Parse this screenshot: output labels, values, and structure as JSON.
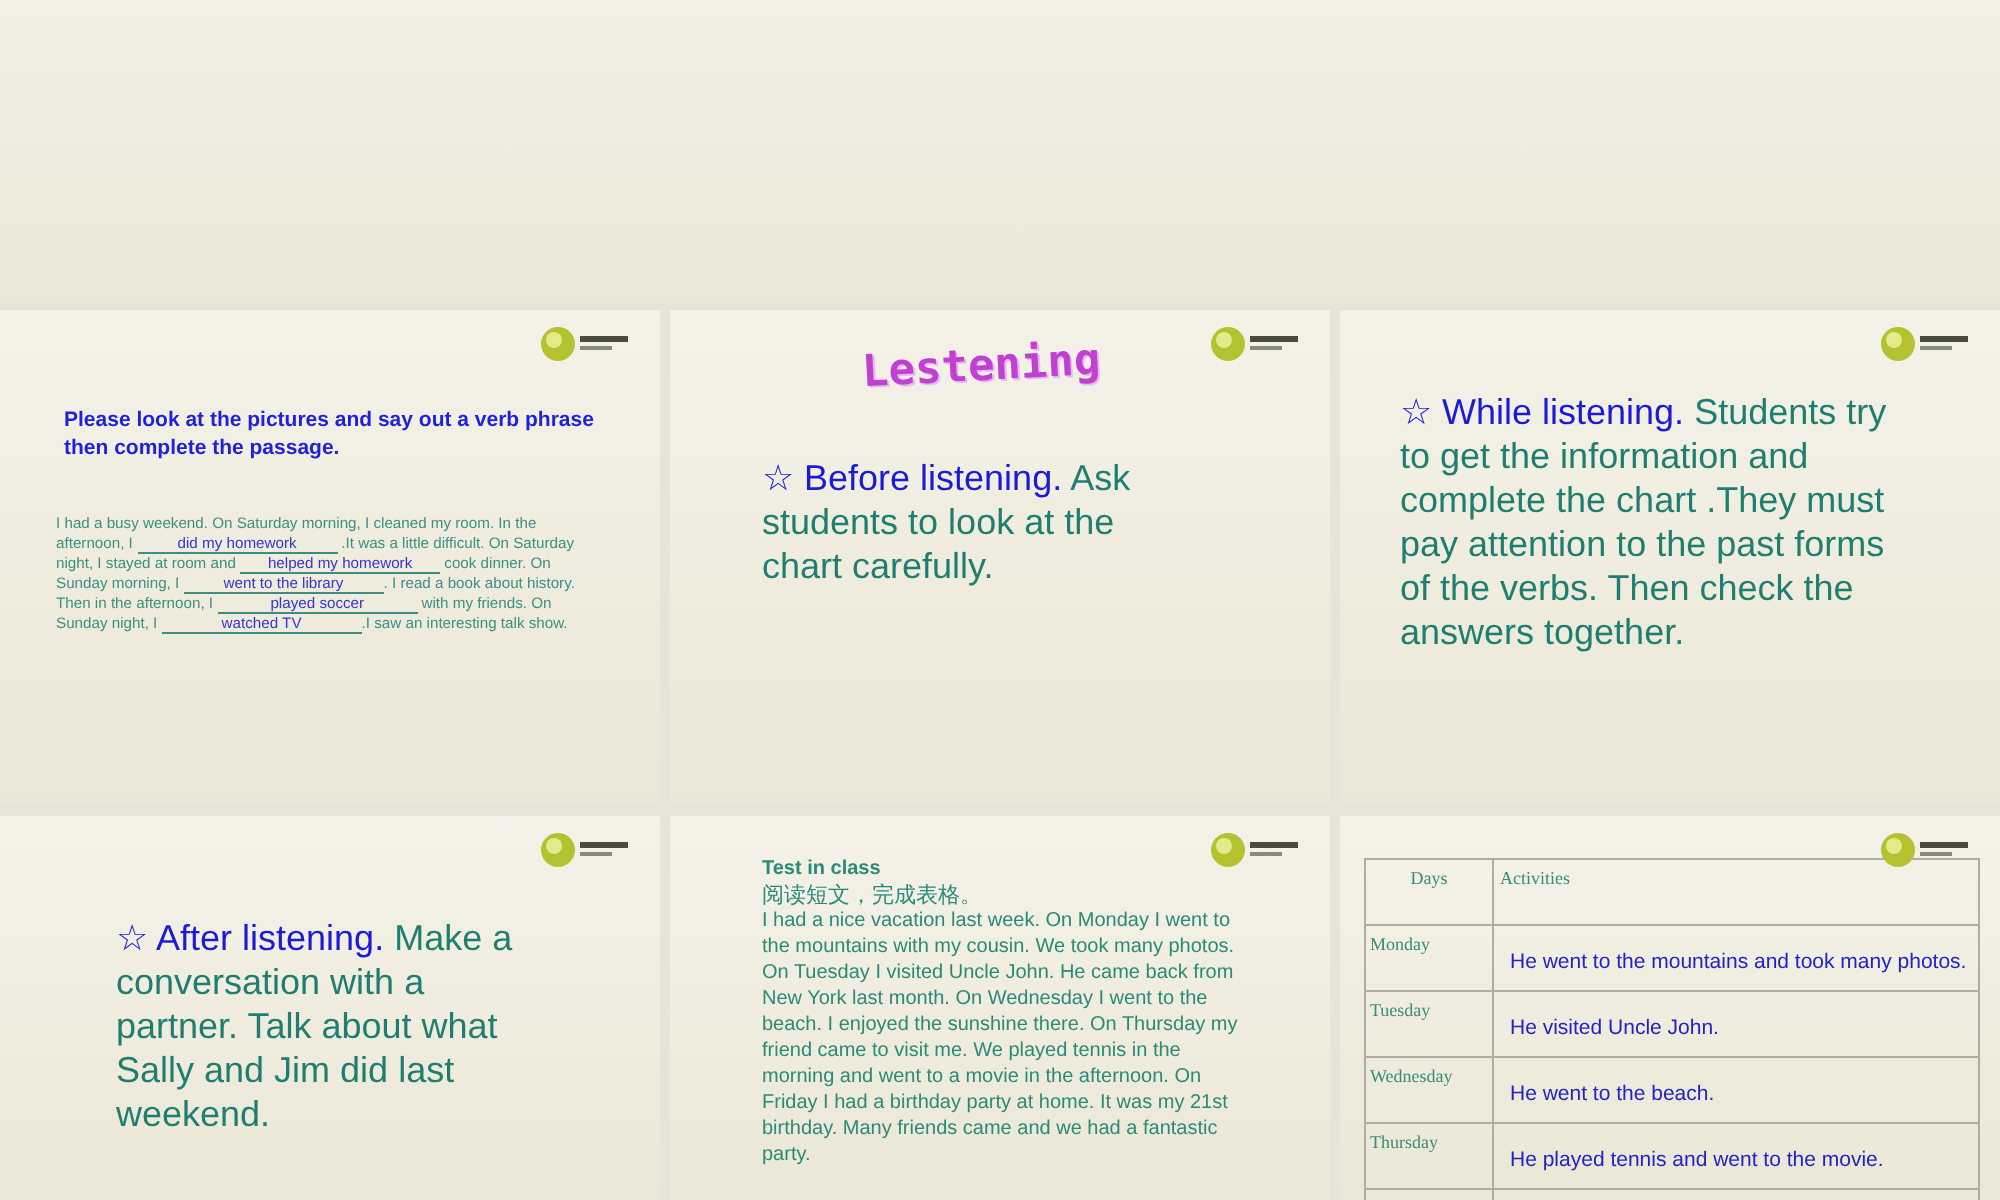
{
  "slides": [
    {
      "kind": "fill_blank",
      "instruction": "Please look at the pictures and say out a verb phrase then complete the passage.",
      "passage": [
        {
          "kind": "text",
          "text": "I had a busy weekend. On Saturday morning, I cleaned my room. In the afternoon, I "
        },
        {
          "kind": "blank",
          "answer": "did my homework"
        },
        {
          "kind": "text",
          "text": " .It was a little difficult. On Saturday night, I stayed at room and "
        },
        {
          "kind": "blank",
          "answer": "helped my homework"
        },
        {
          "kind": "text",
          "text": " cook dinner. On Sunday morning, I "
        },
        {
          "kind": "blank",
          "answer": "went to the library"
        },
        {
          "kind": "text",
          "text": ". I read a book about history. Then in the afternoon, I "
        },
        {
          "kind": "blank",
          "answer": "played soccer"
        },
        {
          "kind": "text",
          "text": " with my friends. On Sunday night, I "
        },
        {
          "kind": "blank",
          "answer": "watched TV"
        },
        {
          "kind": "text",
          "text": ".I saw an interesting talk show."
        }
      ]
    },
    {
      "kind": "bullet",
      "title": "Lestening",
      "lead": "☆ Before listening.",
      "body": "Ask students to look at the chart carefully."
    },
    {
      "kind": "bullet",
      "lead": "☆ While listening.",
      "body": "Students try to get the information and complete the chart .They must  pay attention to the past forms of the verbs. Then check the answers together."
    },
    {
      "kind": "bullet",
      "lead": "☆ After listening.",
      "body": "Make a conversation with a partner. Talk about what Sally and Jim did last weekend."
    },
    {
      "kind": "passage",
      "heading": "Test in class",
      "subheading": "阅读短文，完成表格。",
      "body": "I had a nice vacation last week. On Monday I went to the mountains with my cousin. We took many photos. On Tuesday I visited Uncle John. He came back from New York last month. On Wednesday I went to the beach. I enjoyed the sunshine there. On Thursday my friend came to visit me. We played tennis in the morning and went to a movie in the afternoon. On Friday I had a birthday party at home. It was my 21st birthday. Many friends came and we had a fantastic party."
    },
    {
      "kind": "table",
      "columns": [
        "Days",
        "Activities"
      ],
      "rows": [
        {
          "day": "Monday",
          "activity": "He went to the mountains and took many photos."
        },
        {
          "day": "Tuesday",
          "activity": "He visited Uncle John."
        },
        {
          "day": "Wednesday",
          "activity": "He went to the beach."
        },
        {
          "day": "Thursday",
          "activity": "He played tennis and went to the movie."
        }
      ]
    }
  ]
}
